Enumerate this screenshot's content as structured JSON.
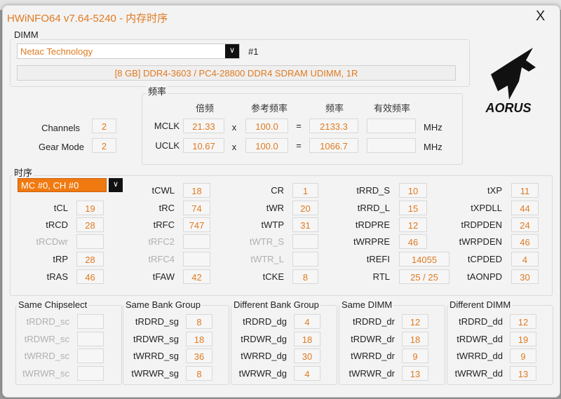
{
  "window": {
    "title": "HWiNFO64 v7.64-5240 - 内存时序",
    "close": "X"
  },
  "dimm": {
    "group_label": "DIMM",
    "manufacturer": "Netac Technology",
    "slot": "#1",
    "info": "[8 GB] DDR4-3603 / PC4-28800 DDR4 SDRAM UDIMM, 1R"
  },
  "logo": {
    "text": "AORUS"
  },
  "general": {
    "channels_label": "Channels",
    "channels": "2",
    "gear_label": "Gear Mode",
    "gear": "2"
  },
  "freq": {
    "group_label": "频率",
    "headers": [
      "倍频",
      "参考频率",
      "频率",
      "有效频率"
    ],
    "rows": [
      {
        "label": "MCLK",
        "mult": "21.33",
        "op1": "x",
        "ref": "100.0",
        "op2": "=",
        "freq": "2133.3",
        "eff": "",
        "unit": "MHz"
      },
      {
        "label": "UCLK",
        "mult": "10.67",
        "op1": "x",
        "ref": "100.0",
        "op2": "=",
        "freq": "1066.7",
        "eff": "",
        "unit": "MHz"
      }
    ]
  },
  "timings": {
    "group_label": "时序",
    "controller": "MC #0, CH #0",
    "columns": [
      [
        null,
        {
          "l": "tCL",
          "v": "19"
        },
        {
          "l": "tRCD",
          "v": "28"
        },
        {
          "l": "tRCDwr",
          "v": "",
          "d": true
        },
        {
          "l": "tRP",
          "v": "28"
        },
        {
          "l": "tRAS",
          "v": "46"
        }
      ],
      [
        {
          "l": "tCWL",
          "v": "18"
        },
        {
          "l": "tRC",
          "v": "74"
        },
        {
          "l": "tRFC",
          "v": "747"
        },
        {
          "l": "tRFC2",
          "v": "",
          "d": true
        },
        {
          "l": "tRFC4",
          "v": "",
          "d": true
        },
        {
          "l": "tFAW",
          "v": "42"
        }
      ],
      [
        {
          "l": "CR",
          "v": "1"
        },
        {
          "l": "tWR",
          "v": "20"
        },
        {
          "l": "tWTP",
          "v": "31"
        },
        {
          "l": "tWTR_S",
          "v": "",
          "d": true
        },
        {
          "l": "tWTR_L",
          "v": "",
          "d": true
        },
        {
          "l": "tCKE",
          "v": "8"
        }
      ],
      [
        {
          "l": "tRRD_S",
          "v": "10"
        },
        {
          "l": "tRRD_L",
          "v": "15"
        },
        {
          "l": "tRDPRE",
          "v": "12"
        },
        {
          "l": "tWRPRE",
          "v": "46"
        },
        {
          "l": "tREFI",
          "v": "14055",
          "w": true
        },
        {
          "l": "RTL",
          "v": "25 / 25",
          "w": true
        }
      ],
      [
        {
          "l": "tXP",
          "v": "11"
        },
        {
          "l": "tXPDLL",
          "v": "44"
        },
        {
          "l": "tRDPDEN",
          "v": "24"
        },
        {
          "l": "tWRPDEN",
          "v": "46"
        },
        {
          "l": "tCPDED",
          "v": "4"
        },
        {
          "l": "tAONPD",
          "v": "30"
        }
      ]
    ]
  },
  "turnaround": [
    {
      "title": "Same Chipselect",
      "rows": [
        {
          "l": "tRDRD_sc",
          "v": "",
          "d": true
        },
        {
          "l": "tRDWR_sc",
          "v": "",
          "d": true
        },
        {
          "l": "tWRRD_sc",
          "v": "",
          "d": true
        },
        {
          "l": "tWRWR_sc",
          "v": "",
          "d": true
        }
      ]
    },
    {
      "title": "Same Bank Group",
      "rows": [
        {
          "l": "tRDRD_sg",
          "v": "8"
        },
        {
          "l": "tRDWR_sg",
          "v": "18"
        },
        {
          "l": "tWRRD_sg",
          "v": "36"
        },
        {
          "l": "tWRWR_sg",
          "v": "8"
        }
      ]
    },
    {
      "title": "Different Bank Group",
      "rows": [
        {
          "l": "tRDRD_dg",
          "v": "4"
        },
        {
          "l": "tRDWR_dg",
          "v": "18"
        },
        {
          "l": "tWRRD_dg",
          "v": "30"
        },
        {
          "l": "tWRWR_dg",
          "v": "4"
        }
      ]
    },
    {
      "title": "Same DIMM",
      "rows": [
        {
          "l": "tRDRD_dr",
          "v": "12"
        },
        {
          "l": "tRDWR_dr",
          "v": "18"
        },
        {
          "l": "tWRRD_dr",
          "v": "9"
        },
        {
          "l": "tWRWR_dr",
          "v": "13"
        }
      ]
    },
    {
      "title": "Different DIMM",
      "rows": [
        {
          "l": "tRDRD_dd",
          "v": "12"
        },
        {
          "l": "tRDWR_dd",
          "v": "19"
        },
        {
          "l": "tWRRD_dd",
          "v": "9"
        },
        {
          "l": "tWRWR_dd",
          "v": "13"
        }
      ]
    }
  ]
}
